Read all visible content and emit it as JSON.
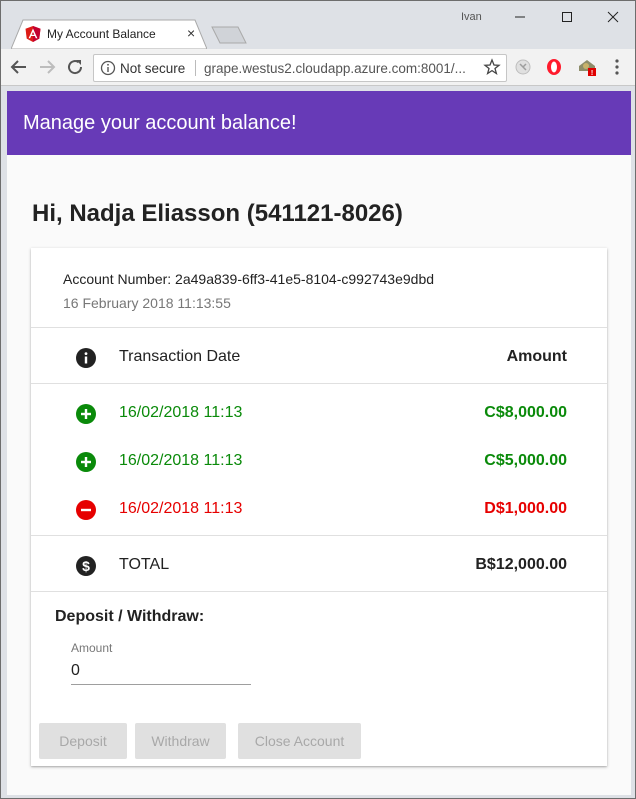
{
  "browser": {
    "tab_title": "My Account Balance",
    "tab_close": "×",
    "user": "Ivan",
    "security_label": "Not secure",
    "url": "grape.westus2.cloudapp.azure.com:8001/..."
  },
  "app": {
    "header_title": "Manage your account balance!",
    "greeting": "Hi, Nadja Eliasson (541121-8026)",
    "account_number": "Account Number: 2a49a839-6ff3-41e5-8104-c992743e9dbd",
    "account_date": "16 February 2018 11:13:55",
    "table": {
      "header_date": "Transaction Date",
      "header_amount": "Amount",
      "rows": [
        {
          "type": "deposit",
          "date": "16/02/2018 11:13",
          "amount": "C$8,000.00",
          "color": "#0a8a0a"
        },
        {
          "type": "deposit",
          "date": "16/02/2018 11:13",
          "amount": "C$5,000.00",
          "color": "#0a8a0a"
        },
        {
          "type": "withdraw",
          "date": "16/02/2018 11:13",
          "amount": "D$1,000.00",
          "color": "#e60000"
        }
      ],
      "total_label": "TOTAL",
      "total_amount": "B$12,000.00"
    },
    "form": {
      "title": "Deposit / Withdraw:",
      "amount_label": "Amount",
      "amount_value": "0"
    },
    "buttons": {
      "deposit": "Deposit",
      "withdraw": "Withdraw",
      "close_account": "Close Account"
    },
    "colors": {
      "header": "#673ab7",
      "positive": "#0a8a0a",
      "negative": "#e60000"
    }
  }
}
